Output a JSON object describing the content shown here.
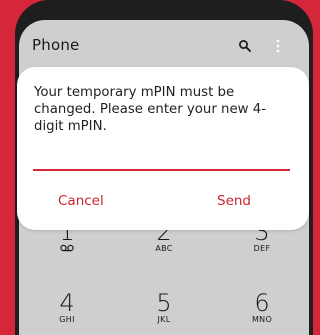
{
  "app": {
    "title": "Phone"
  },
  "keypad": [
    {
      "digit": "1",
      "letters": ""
    },
    {
      "digit": "2",
      "letters": "ABC"
    },
    {
      "digit": "3",
      "letters": "DEF"
    },
    {
      "digit": "4",
      "letters": "GHI"
    },
    {
      "digit": "5",
      "letters": "JKL"
    },
    {
      "digit": "6",
      "letters": "MNO"
    }
  ],
  "dialog": {
    "message": "Your temporary mPIN must be changed. Please enter your new 4-digit mPIN.",
    "pin_value": "",
    "cancel_label": "Cancel",
    "send_label": "Send"
  },
  "colors": {
    "frame": "#d6263a",
    "accent": "#c8262f",
    "app_background": "#cfcfcf"
  },
  "icons": {
    "search": "search-icon",
    "more": "more-vert-icon",
    "voicemail": "voicemail-icon"
  }
}
